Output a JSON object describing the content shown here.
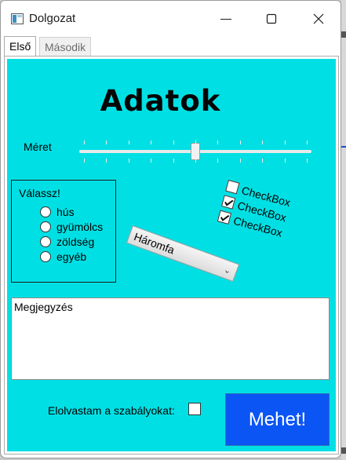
{
  "window": {
    "title": "Dolgozat",
    "icon": "app-window-icon",
    "controls": [
      "minimize-icon",
      "maximize-icon",
      "close-icon"
    ]
  },
  "tabs": [
    {
      "label": "Első",
      "active": true
    },
    {
      "label": "Második",
      "active": false
    }
  ],
  "panel": {
    "background": "#00e0e4",
    "heading": "Adatok",
    "size": {
      "label": "Méret",
      "value_fraction": 0.5,
      "tick_count": 10
    }
  },
  "group": {
    "title": "Válassz!",
    "options": [
      "hús",
      "gyümölcs",
      "zöldség",
      "egyéb"
    ]
  },
  "combo": {
    "selected": "Háromfa"
  },
  "checkboxes": [
    {
      "label": "CheckBox",
      "checked": false
    },
    {
      "label": "CheckBox",
      "checked": true
    },
    {
      "label": "CheckBox",
      "checked": true
    }
  ],
  "notes": {
    "value": "Megjegyzés"
  },
  "agree": {
    "label": "Elolvastam a szabályokat:",
    "checked": false
  },
  "submit": {
    "label": "Mehet!",
    "color": "#0b55f5"
  }
}
